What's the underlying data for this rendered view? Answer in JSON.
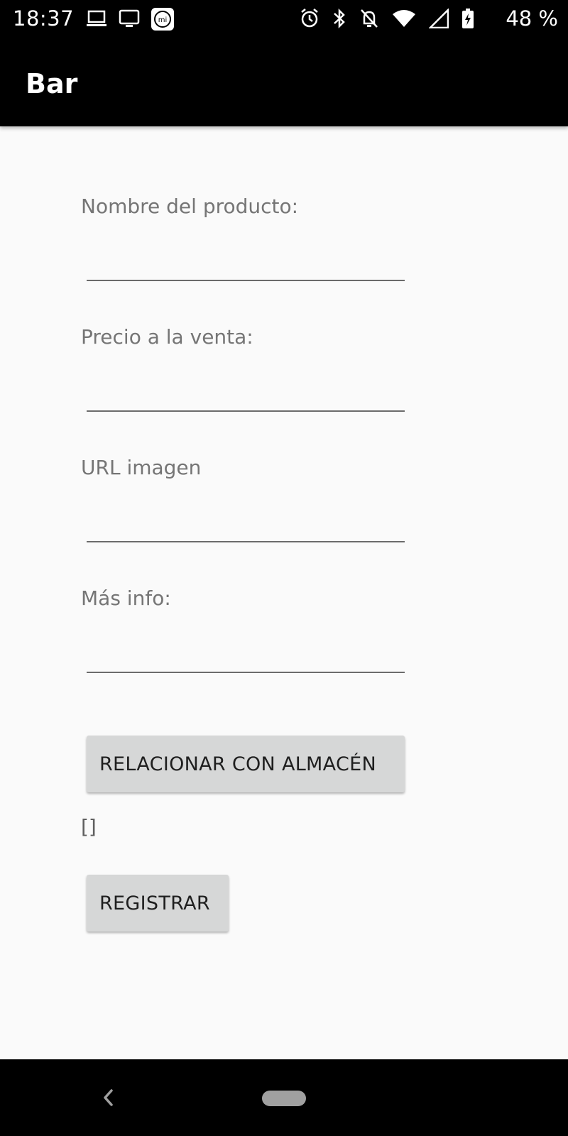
{
  "status_bar": {
    "time": "18:37",
    "battery": "48 %",
    "left_icons": [
      "laptop-icon",
      "monitor-icon",
      "mi-app-icon"
    ],
    "right_icons": [
      "alarm-icon",
      "bluetooth-icon",
      "notifications-off-icon",
      "wifi-icon",
      "signal-icon",
      "battery-icon"
    ]
  },
  "app_bar": {
    "title": "Bar"
  },
  "form": {
    "fields": [
      {
        "label": "Nombre del producto:",
        "value": "",
        "placeholder": ""
      },
      {
        "label": "Precio a la venta:",
        "value": "",
        "placeholder": ""
      },
      {
        "label": "URL imagen",
        "value": "",
        "placeholder": ""
      },
      {
        "label": "Más info:",
        "value": "",
        "placeholder": ""
      }
    ],
    "relate_button_label": "RELACIONAR CON ALMACÉN",
    "list_text": "[]",
    "register_button_label": "REGISTRAR"
  },
  "nav_bar": {
    "back_icon": "back-icon",
    "home_icon": "home-pill-icon"
  },
  "colors": {
    "background": "#fafafa",
    "bars": "#000000",
    "button": "#d6d7d7",
    "label": "#757575"
  }
}
